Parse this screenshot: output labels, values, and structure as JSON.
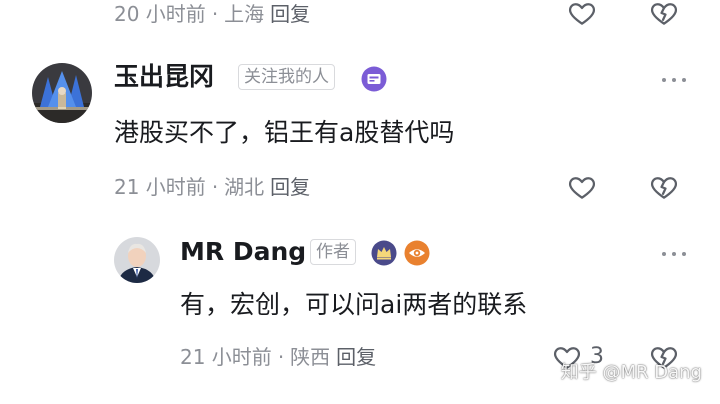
{
  "top_comment": {
    "time": "20 小时前",
    "location": "上海",
    "reply_label": "回复"
  },
  "comment1": {
    "author": "玉出昆冈",
    "relation_tag": "关注我的人",
    "content": "港股买不了，铝王有a股替代吗",
    "time": "21 小时前",
    "location": "湖北",
    "reply_label": "回复"
  },
  "reply1": {
    "author": "MR Dang",
    "role_tag": "作者",
    "content": "有，宏创，可以问ai两者的联系",
    "time": "21 小时前",
    "location": "陕西",
    "reply_label": "回复",
    "like_count": "3"
  },
  "watermark": "知乎 @MR Dang",
  "separator": "·",
  "colors": {
    "meta_gray": "#8c8f96",
    "text_dark": "#191b1f",
    "badge_purple": "#7b5cd6",
    "badge_crown": "#4a4a8a",
    "badge_orange": "#e9812f"
  }
}
